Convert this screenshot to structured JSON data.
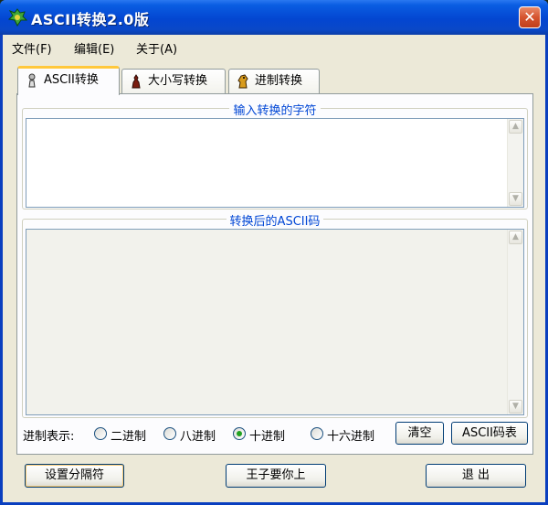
{
  "window": {
    "title": "ASCII转换2.0版",
    "close_glyph": "✕"
  },
  "menu": {
    "items": [
      {
        "label": "文件(F)"
      },
      {
        "label": "编辑(E)"
      },
      {
        "label": "关于(A)"
      }
    ]
  },
  "tabs": [
    {
      "label": "ASCII转换",
      "icon": "chess-pawn-icon",
      "active": true
    },
    {
      "label": "大小写转换",
      "icon": "chess-piece-icon",
      "active": false
    },
    {
      "label": "进制转换",
      "icon": "chess-knight-icon",
      "active": false
    }
  ],
  "input_group": {
    "title": "输入转换的字符",
    "value": ""
  },
  "output_group": {
    "title": "转换后的ASCII码",
    "value": ""
  },
  "radix": {
    "label": "进制表示:",
    "options": [
      {
        "label": "二进制",
        "checked": false
      },
      {
        "label": "八进制",
        "checked": false
      },
      {
        "label": "十进制",
        "checked": true
      },
      {
        "label": "十六进制",
        "checked": false
      }
    ]
  },
  "buttons": {
    "clear": "清空",
    "ascii_table": "ASCII码表",
    "set_separator": "设置分隔符",
    "prince": "王子要你上",
    "exit": "退 出"
  },
  "colors": {
    "titlebar": "#0346d1",
    "group_title": "#0046d5",
    "active_tab_accent": "#ffc83c"
  }
}
